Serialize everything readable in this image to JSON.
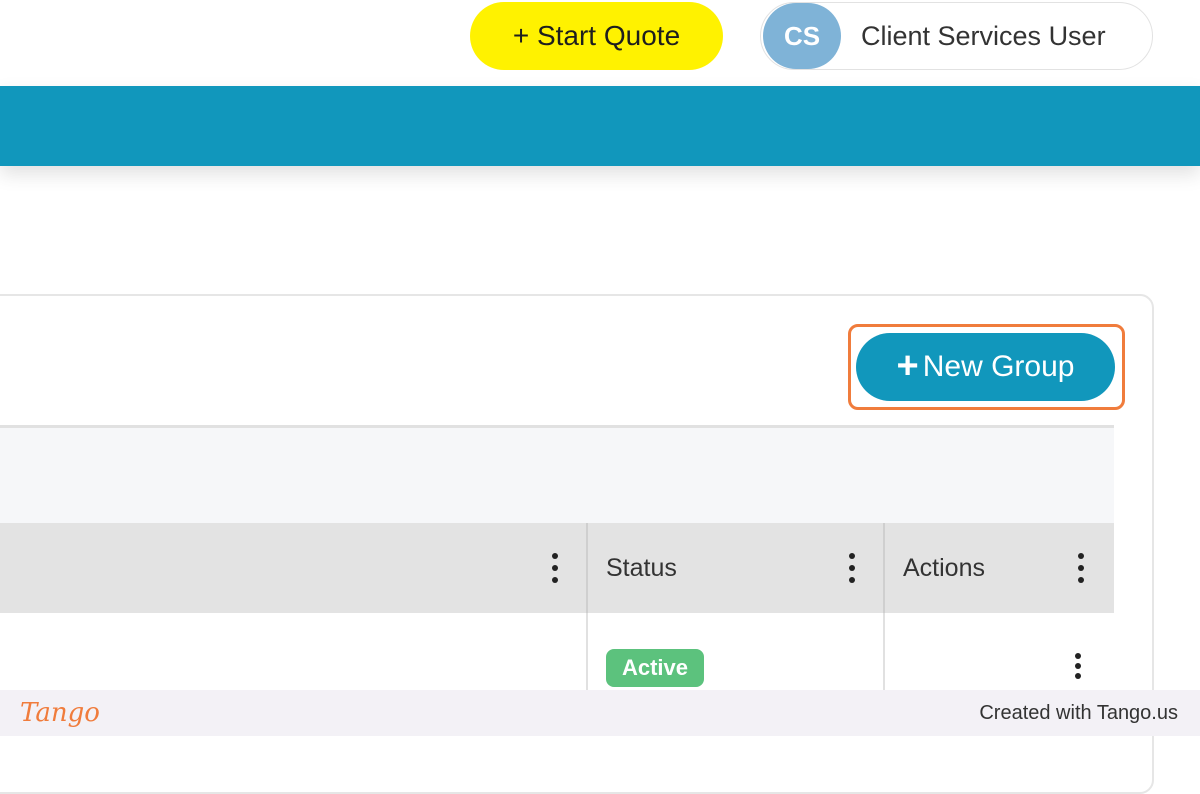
{
  "header": {
    "start_quote_label": "+ Start Quote",
    "user": {
      "initials": "CS",
      "name": "Client Services User"
    }
  },
  "colors": {
    "accent": "#1197bc",
    "start_quote": "#fff200",
    "highlight": "#f07c3c",
    "status_active": "#5cc27d"
  },
  "main": {
    "new_group_label": "New Group",
    "table": {
      "columns": [
        "",
        "Status",
        "Actions"
      ],
      "rows": [
        {
          "status": "Active"
        }
      ]
    }
  },
  "footer": {
    "logo": "Tango",
    "credit": "Created with Tango.us"
  }
}
